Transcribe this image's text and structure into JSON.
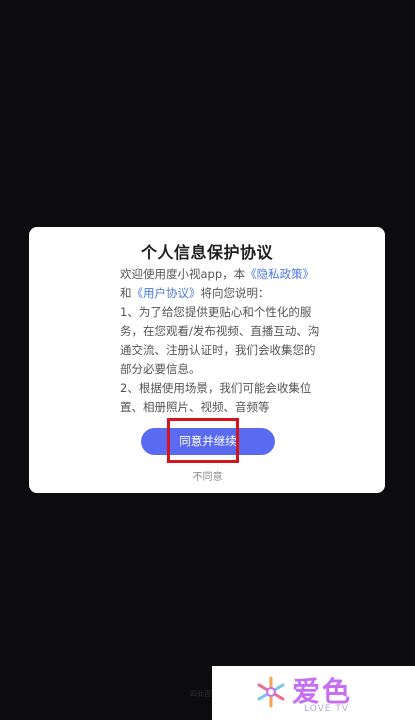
{
  "dialog": {
    "title": "个人信息保护协议",
    "body": {
      "line1_prefix": "欢迎使用度小视app，本",
      "privacy_link": "《隐私政策》",
      "and": "和",
      "user_agreement_link": "《用户协议》",
      "line_suffix": "将向您说明：",
      "point1": "1、为了给您提供更贴心和个性化的服务，在您观看/发布视频、直播互动、沟通交流、注册认证时，我们会收集您的部分必要信息。",
      "point2": "2、根据使用场景，我们可能会收集位置、相册照片、视频、音频等"
    },
    "agree_button": "同意并继续",
    "disagree_link": "不同意"
  },
  "bottom_hint": "四此否",
  "watermark": {
    "title": "爱色",
    "subtitle": "LOVE TV"
  },
  "colors": {
    "background": "#0c0c0f",
    "button": "#5b6bf1",
    "link": "#4a78e0",
    "highlight": "#d3151d"
  }
}
